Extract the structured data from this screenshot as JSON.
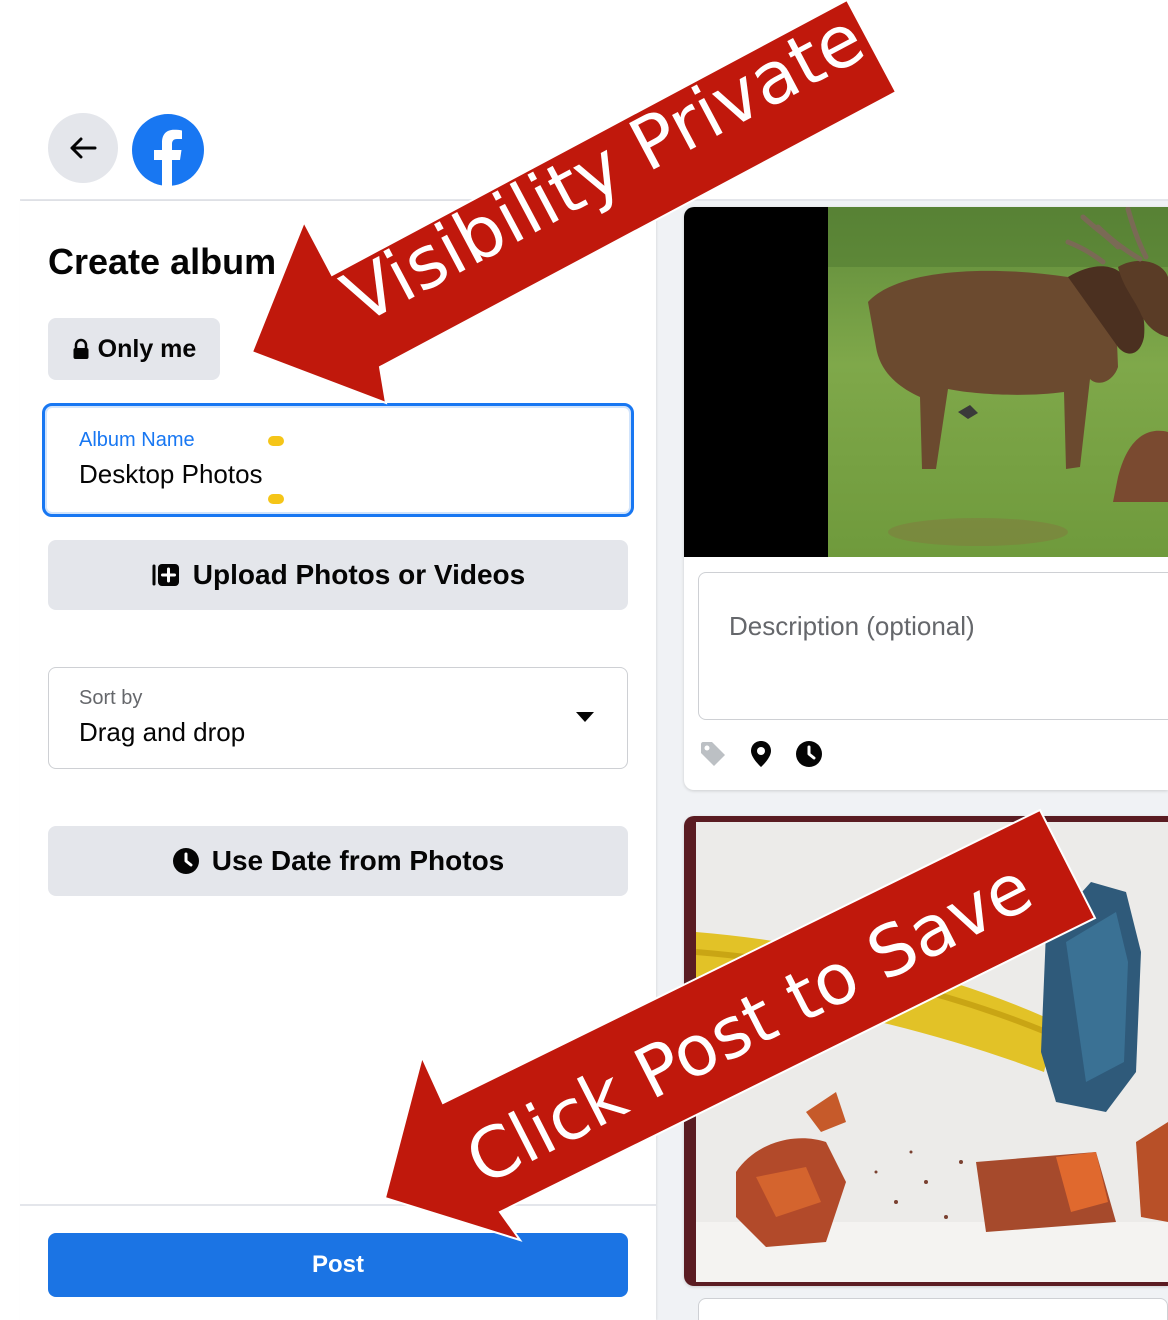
{
  "header": {
    "back_icon": "arrow-left-icon",
    "logo": "facebook-logo"
  },
  "left_panel": {
    "title": "Create album",
    "privacy_label": "Only me",
    "privacy_icon": "lock-icon",
    "album_name_label": "Album Name",
    "album_name_value": "Desktop Photos",
    "upload_label": "Upload Photos or Videos",
    "upload_icon": "add-photo-icon",
    "sort_label": "Sort by",
    "sort_value": "Drag and drop",
    "date_label": "Use Date from Photos",
    "date_icon": "clock-icon",
    "post_label": "Post"
  },
  "right_panel": {
    "description_placeholder": "Description (optional)",
    "meta_icons": [
      "tag-icon",
      "location-pin-icon",
      "clock-icon"
    ]
  },
  "annotations": {
    "visibility_text": "Visibility Private",
    "post_text": "Click Post to Save",
    "arrow_color": "#c0180c"
  },
  "colors": {
    "accent": "#1b74e4",
    "button_bg": "#e4e6eb",
    "panel_bg": "#f0f2f5"
  }
}
